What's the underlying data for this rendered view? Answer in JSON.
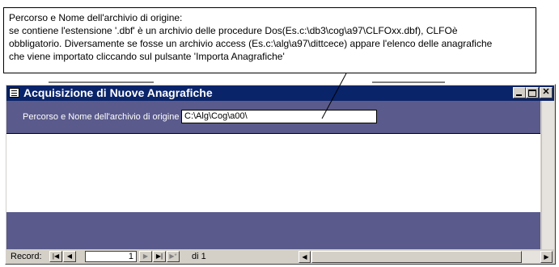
{
  "callout": {
    "lines": [
      "Percorso e Nome dell'archivio di origine:",
      "se contiene l'estensione '.dbf' è un archivio delle procedure Dos(Es.c:\\db3\\cog\\a97\\CLFOxx.dbf), CLFOè",
      "obbligatorio. Diversamente se fosse un archivio access (Es.c:\\alg\\a97\\dittcece) appare l'elenco delle anagrafiche",
      "che viene importato cliccando sul pulsante 'Importa Anagrafiche'"
    ]
  },
  "window": {
    "title": "Acquisizione di Nuove Anagrafiche",
    "colors": {
      "titlebar": "#0a246a",
      "section": "#5a5a8c"
    }
  },
  "form": {
    "path_label": "Percorso e Nome dell'archivio di origine :",
    "path_value": "C:\\Alg\\Cog\\a00\\"
  },
  "navigation": {
    "record_label": "Record:",
    "current_record": "1",
    "of_label": "di 1",
    "icons": [
      "first-record-icon",
      "previous-record-icon",
      "next-record-icon",
      "last-record-icon",
      "new-record-icon"
    ]
  }
}
